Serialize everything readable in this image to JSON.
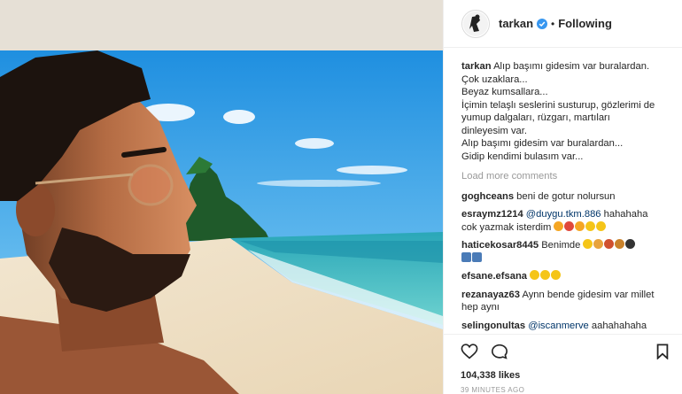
{
  "post": {
    "username": "tarkan",
    "separator": "•",
    "follow_status": "Following",
    "caption_user": "tarkan",
    "caption_lines": [
      "Alıp başımı gidesim var buralardan.",
      "Çok uzaklara...",
      "Beyaz kumsallara...",
      "İçimin telaşlı seslerini susturup, gözlerimi de",
      "yumup dalgaları, rüzgarı, martıları",
      "dinleyesim var.",
      "Alıp başımı gidesim var buralardan...",
      "Gidip kendimi bulasım var..."
    ],
    "load_more": "Load more comments",
    "likes": "104,338 likes",
    "time_ago": "39 MINUTES AGO"
  },
  "comments": [
    {
      "user": "goghceans",
      "text": "beni de gotur nolursun"
    },
    {
      "user": "esraymz1214",
      "mention": "@duygu.tkm.886",
      "text": "hahahaha",
      "text2": "cok yazmak isterdim",
      "emojis": [
        "#f5a623",
        "#e0483b",
        "#f5a623",
        "#f5c518",
        "#f5c518"
      ]
    },
    {
      "user": "haticekosar8445",
      "text": "Benimde",
      "emojis": [
        "#f5c518",
        "#e8a33d",
        "#d0502f",
        "#c9822b",
        "#333333"
      ],
      "emojis2": [
        "#4a7bb7",
        "#4a7bb7"
      ]
    },
    {
      "user": "efsane.efsana",
      "emojis": [
        "#f5c518",
        "#f5c518",
        "#f5c518"
      ]
    },
    {
      "user": "rezanayaz63",
      "text": "Aynn bende gidesim var millet",
      "text2": "hep aynı"
    },
    {
      "user": "selingonultas",
      "mention": "@iscanmerve",
      "text": "aahahahaha"
    }
  ],
  "icons": {
    "like": "heart-icon",
    "comment": "comment-icon",
    "save": "bookmark-icon",
    "verified": "verified-badge-icon"
  },
  "colors": {
    "verified": "#3897f0",
    "mention": "#003569",
    "muted": "#999999"
  }
}
